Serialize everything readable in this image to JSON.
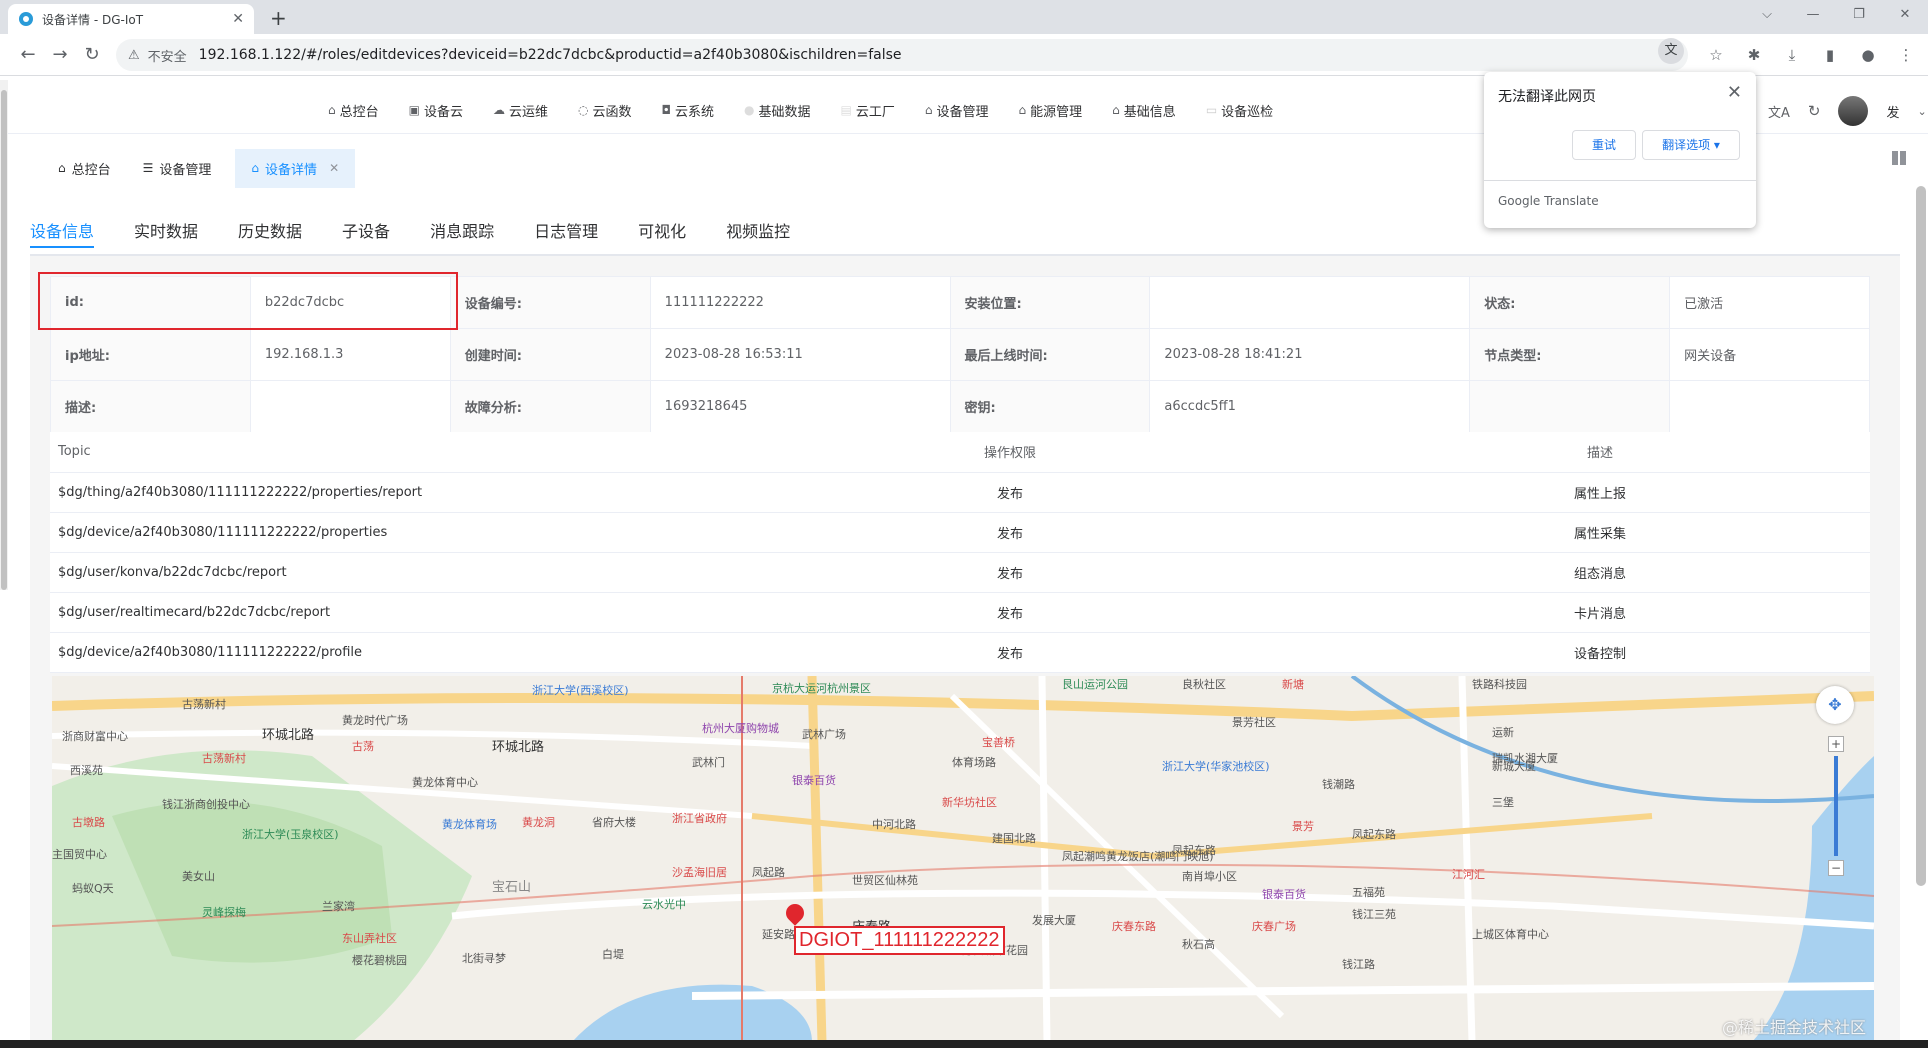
{
  "browser": {
    "tab_title": "设备详情 - DG-IoT",
    "address_warning": "不安全",
    "url": "192.168.1.122/#/roles/editdevices?deviceid=b22dc7dcbc&productid=a2f40b3080&ischildren=false"
  },
  "translate_popup": {
    "title": "无法翻译此网页",
    "retry_label": "重试",
    "options_label": "翻译选项",
    "brand": "Google Translate"
  },
  "app_menu": [
    {
      "icon": "home-icon",
      "label": "总控台"
    },
    {
      "icon": "cloud-device-icon",
      "label": "设备云"
    },
    {
      "icon": "cloud-ops-icon",
      "label": "云运维"
    },
    {
      "icon": "cloud-func-icon",
      "label": "云函数"
    },
    {
      "icon": "cloud-system-icon",
      "label": "云系统"
    },
    {
      "icon": "data-icon",
      "label": "基础数据"
    },
    {
      "icon": "factory-icon",
      "label": "云工厂"
    },
    {
      "icon": "device-manage-icon",
      "label": "设备管理"
    },
    {
      "icon": "energy-icon",
      "label": "能源管理"
    },
    {
      "icon": "info-icon",
      "label": "基础信息"
    },
    {
      "icon": "patrol-icon",
      "label": "设备巡检"
    }
  ],
  "user": {
    "name_short": "发"
  },
  "breadcrumb_tabs": [
    {
      "label": "总控台",
      "active": false
    },
    {
      "label": "设备管理",
      "active": false
    },
    {
      "label": "设备详情",
      "active": true
    }
  ],
  "sub_tabs": [
    "设备信息",
    "实时数据",
    "历史数据",
    "子设备",
    "消息跟踪",
    "日志管理",
    "可视化",
    "视频监控"
  ],
  "device_info": {
    "row1": {
      "l1": "id:",
      "v1": "b22dc7dcbc",
      "l2": "设备编号:",
      "v2": "111111222222",
      "l3": "安装位置:",
      "v3": "",
      "l4": "状态:",
      "v4": "已激活"
    },
    "row2": {
      "l1": "ip地址:",
      "v1": "192.168.1.3",
      "l2": "创建时间:",
      "v2": "2023-08-28 16:53:11",
      "l3": "最后上线时间:",
      "v3": "2023-08-28 18:41:21",
      "l4": "节点类型:",
      "v4": "网关设备"
    },
    "row3": {
      "l1": "描述:",
      "v1": "",
      "l2": "故障分析:",
      "v2": "1693218645",
      "l3": "密钥:",
      "v3": "a6ccdc5ff1",
      "l4": "",
      "v4": ""
    }
  },
  "topic_table": {
    "headers": [
      "Topic",
      "操作权限",
      "描述"
    ],
    "rows": [
      [
        "$dg/thing/a2f40b3080/111111222222/properties/report",
        "发布",
        "属性上报"
      ],
      [
        "$dg/device/a2f40b3080/111111222222/properties",
        "发布",
        "属性采集"
      ],
      [
        "$dg/user/konva/b22dc7dcbc/report",
        "发布",
        "组态消息"
      ],
      [
        "$dg/user/realtimecard/b22dc7dcbc/report",
        "发布",
        "卡片消息"
      ],
      [
        "$dg/device/a2f40b3080/111111222222/profile",
        "发布",
        "设备控制"
      ]
    ]
  },
  "map": {
    "marker_label": "DGIOT_111111222222",
    "labels": {
      "l1": "古荡新村",
      "l2": "黄龙时代广场",
      "l3": "浙江大学(西溪校区)",
      "l4": "京杭大运河杭州景区",
      "l5": "艮山运河公园",
      "l6": "新塘",
      "l7": "浙商财富中心",
      "l8": "环城北路",
      "l9": "古荡",
      "l10": "环城北路",
      "l11": "杭州大厦购物城",
      "l12": "武林广场",
      "l13": "宝善桥",
      "l14": "景芳社区",
      "l15": "古荡新村",
      "l16": "西溪苑",
      "l17": "武林门",
      "l18": "体育场路",
      "l19": "浙江大学(华家池校区)",
      "l20": "瑞凯水湘大厦",
      "l21": "黄龙体育中心",
      "l22": "银泰百货",
      "l23": "新华坊社区",
      "l24": "钱江浙商创投中心",
      "l25": "古墩路",
      "l26": "黄龙体育场",
      "l27": "黄龙洞",
      "l28": "省府大楼",
      "l29": "浙江省政府",
      "l30": "中河北路",
      "l31": "建国北路",
      "l32": "景芳",
      "l33": "浙江大学(玉泉校区)",
      "l34": "凤起路",
      "l35": "沙孟海旧居",
      "l36": "凤起东路",
      "l37": "凤起潮鸣黄龙饭店(潮鸣门映旭)",
      "l38": "南肖埠小区",
      "l39": "江河汇",
      "l40": "美女山",
      "l41": "宝石山",
      "l42": "世贸区仙林苑",
      "l43": "银泰百货",
      "l44": "五福苑",
      "l45": "灵峰探梅",
      "l46": "云水光中",
      "l47": "庆春路",
      "l48": "发展大厦",
      "l49": "庆春东路",
      "l50": "庆春广场",
      "l51": "东山弄社区",
      "l52": "北街寻梦",
      "l53": "白堤",
      "l54": "延安路",
      "l55": "万安城市花园",
      "l56": "钱江路",
      "l57": "秋石高",
      "l58": "上城区体育中心",
      "l59": "三堡",
      "l60": "新城大厦",
      "l61": "运新",
      "l62": "钱潮路",
      "l63": "凤起东路",
      "l64": "主国贸中心",
      "l65": "蚂蚁Q天",
      "l66": "兰家湾",
      "l67": "樱花碧桃园",
      "l68": "钱江三苑",
      "l69": "良秋社区",
      "l70": "铁路科技园"
    },
    "watermark": "@稀土掘金技术社区"
  },
  "colors": {
    "accent": "#1890ff",
    "highlight": "#e0262d"
  }
}
